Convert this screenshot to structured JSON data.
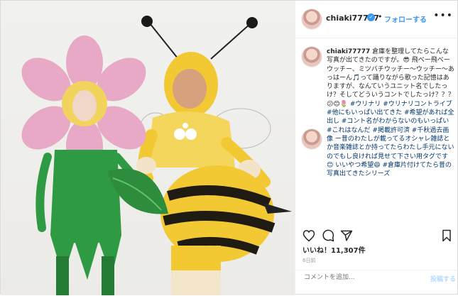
{
  "header": {
    "username": "chiaki77777",
    "verified_icon": "✓",
    "separator": "•",
    "follow_label": "フォローする",
    "more_icon": "•••"
  },
  "caption": {
    "username": "chiaki77777",
    "text": "倉庫を整理してたらこんな写真が出てきたのですが。😎 飛べー飛べーウッチー、ミツバチウッチー〜ウッチー〜あっはーん🎵って踊りながら歌った記憶はありますが、なんていうユニット名でしたっけ？そしてどういうコントでしたっけ？？？😕😊🌷 ",
    "tags": "#ウリナリ #ウリナリコントライブ #他にもいっぱい出てきた #希望があれば全出し #コント名がわからないのもいっぱい #これはなんだ #掲載許可済 #千秋過去画像 ー昔のわたしが載ってるオシャレ雑誌とか音楽雑誌とか持ってたらわたし手元にないのでもし良ければ見せて下さい用タグです😊 いいやつ希望😄 #倉庫片付けてたら昔の写真出てきたシリーズ"
  },
  "actions": {
    "likes": "いいね！11,307件",
    "date": "6日前"
  },
  "comment": {
    "placeholder": "コメントを追加...",
    "post_label": "投稿する"
  },
  "colors": {
    "link": "#3897f0",
    "tag": "#003569"
  }
}
